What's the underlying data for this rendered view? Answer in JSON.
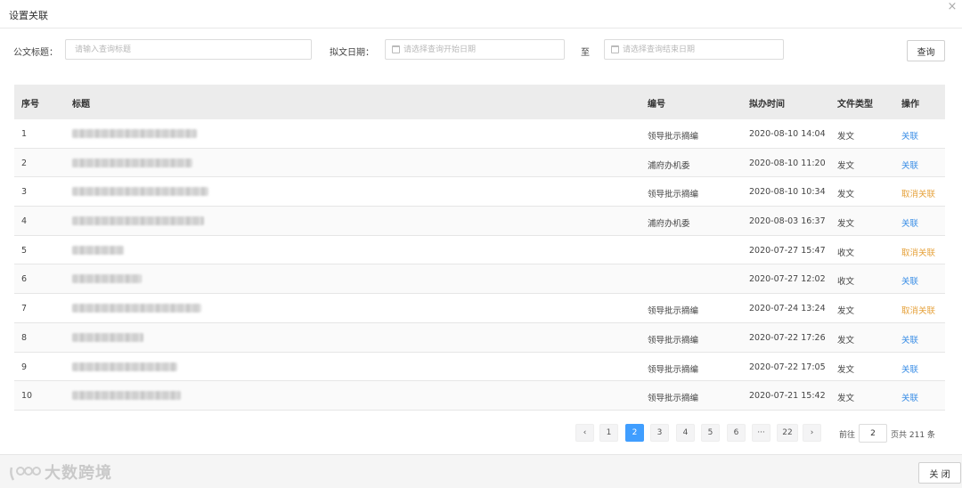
{
  "dialog": {
    "title": "设置关联",
    "close_icon": "×"
  },
  "search": {
    "title_label": "公文标题：",
    "title_placeholder": "请输入查询标题",
    "date_label": "拟文日期：",
    "start_placeholder": "请选择查询开始日期",
    "to_label": "至",
    "end_placeholder": "请选择查询结束日期",
    "query_button": "查询"
  },
  "table": {
    "headers": {
      "index": "序号",
      "title": "标题",
      "number": "编号",
      "time": "拟办时间",
      "type": "文件类型",
      "action": "操作"
    },
    "rows": [
      {
        "index": "1",
        "number": "领导批示摘编",
        "time": "2020-08-10  14:04",
        "type": "发文",
        "action": "关联",
        "action_kind": "link"
      },
      {
        "index": "2",
        "number": "浦府办机委",
        "time": "2020-08-10  11:20",
        "type": "发文",
        "action": "关联",
        "action_kind": "link"
      },
      {
        "index": "3",
        "number": "领导批示摘编",
        "time": "2020-08-10  10:34",
        "type": "发文",
        "action": "取消关联",
        "action_kind": "unlink"
      },
      {
        "index": "4",
        "number": "浦府办机委",
        "time": "2020-08-03  16:37",
        "type": "发文",
        "action": "关联",
        "action_kind": "link"
      },
      {
        "index": "5",
        "number": "",
        "time": "2020-07-27  15:47",
        "type": "收文",
        "action": "取消关联",
        "action_kind": "unlink"
      },
      {
        "index": "6",
        "number": "",
        "time": "2020-07-27  12:02",
        "type": "收文",
        "action": "关联",
        "action_kind": "link"
      },
      {
        "index": "7",
        "number": "领导批示摘编",
        "time": "2020-07-24  13:24",
        "type": "发文",
        "action": "取消关联",
        "action_kind": "unlink"
      },
      {
        "index": "8",
        "number": "领导批示摘编",
        "time": "2020-07-22  17:26",
        "type": "发文",
        "action": "关联",
        "action_kind": "link"
      },
      {
        "index": "9",
        "number": "领导批示摘编",
        "time": "2020-07-22  17:05",
        "type": "发文",
        "action": "关联",
        "action_kind": "link"
      },
      {
        "index": "10",
        "number": "领导批示摘编",
        "time": "2020-07-21  15:42",
        "type": "发文",
        "action": "关联",
        "action_kind": "link"
      }
    ]
  },
  "pagination": {
    "prev_icon": "‹",
    "next_icon": "›",
    "pages": [
      "1",
      "2",
      "3",
      "4",
      "5",
      "6",
      "···",
      "22"
    ],
    "current": "2",
    "goto_prefix": "前往",
    "goto_value": "2",
    "goto_suffix": "页共 211 条"
  },
  "footer": {
    "close_button": "关 闭",
    "watermark": "大数跨境"
  },
  "colors": {
    "link": "#3a8ee6",
    "unlink": "#e6a23c",
    "active_page": "#409eff"
  }
}
